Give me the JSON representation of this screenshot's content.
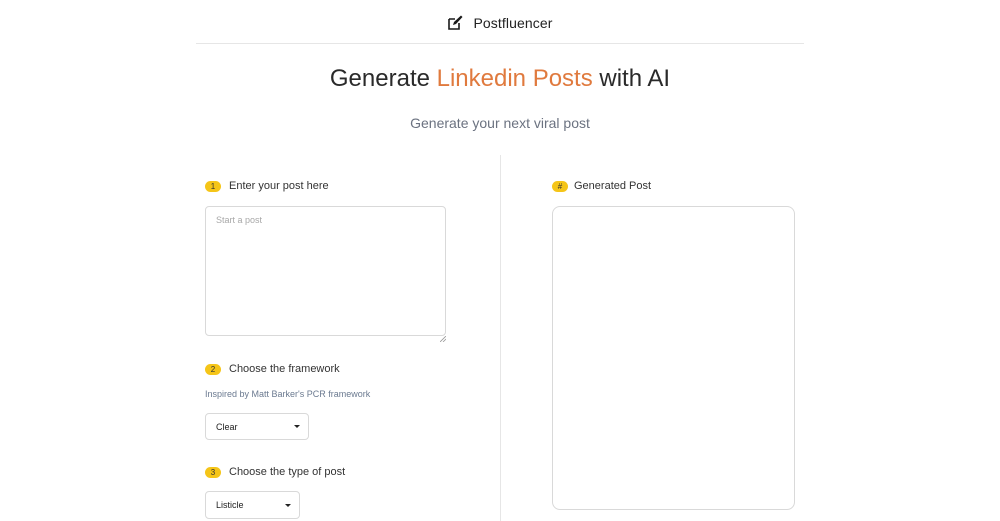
{
  "header": {
    "brand_name": "Postfluencer",
    "brand_icon": "edit-icon"
  },
  "hero": {
    "title_prefix": "Generate ",
    "title_accent": "Linkedin Posts",
    "title_suffix": " with AI",
    "subtitle": "Generate your next viral post",
    "accent_color": "#e07a3e"
  },
  "input_panel": {
    "step1": {
      "number": "1",
      "label": "Enter your post here"
    },
    "post_input": {
      "placeholder": "Start a post",
      "value": ""
    },
    "step2": {
      "number": "2",
      "label": "Choose the framework"
    },
    "framework_hint": "Inspired by Matt Barker's PCR framework",
    "framework_select": {
      "value": "Clear"
    },
    "step3": {
      "number": "3",
      "label": "Choose the type of post"
    },
    "post_type_select": {
      "value": "Listicle"
    }
  },
  "output_panel": {
    "badge": "#",
    "label": "Generated Post",
    "content": ""
  },
  "colors": {
    "badge": "#f5c518",
    "border": "#d9d9d9"
  }
}
